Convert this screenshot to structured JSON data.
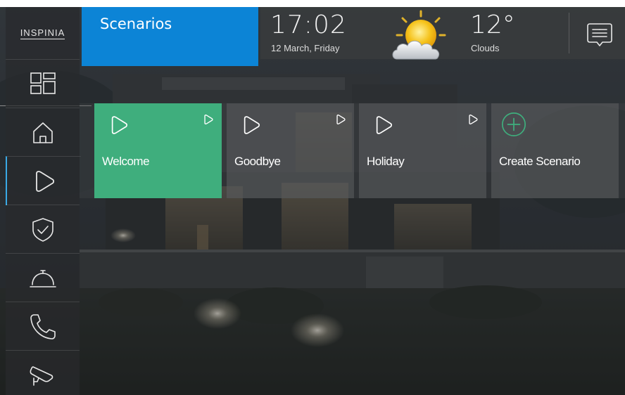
{
  "app": {
    "logo_text": "INSPINIA"
  },
  "sidebar": {
    "items": [
      {
        "name": "dashboard",
        "icon": "dashboard-icon"
      },
      {
        "name": "home",
        "icon": "house-icon"
      },
      {
        "name": "scenarios",
        "icon": "play-icon",
        "active": true
      },
      {
        "name": "security",
        "icon": "shield-check-icon"
      },
      {
        "name": "services",
        "icon": "service-bell-icon"
      },
      {
        "name": "calls",
        "icon": "phone-icon"
      },
      {
        "name": "cameras",
        "icon": "security-camera-icon"
      }
    ]
  },
  "header": {
    "title": "Scenarios",
    "time": "17:02",
    "date": "12 March, Friday",
    "temperature": "12°",
    "weather": "Clouds",
    "weather_icon": "sun-cloud-icon",
    "messages_icon": "message-icon"
  },
  "scenarios": [
    {
      "label": "Welcome",
      "style": "active"
    },
    {
      "label": "Goodbye",
      "style": "normal"
    },
    {
      "label": "Holiday",
      "style": "normal"
    },
    {
      "label": "Create Scenario",
      "style": "create"
    }
  ],
  "colors": {
    "title_tile": "#0c84d6",
    "active_tile": "#3fae7d",
    "create_icon": "#3fae7d",
    "sidebar_active_marker": "#3aa9e6"
  }
}
